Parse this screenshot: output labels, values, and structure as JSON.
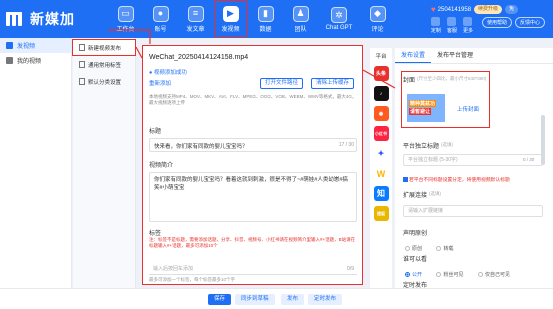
{
  "app": {
    "title": "新媒加"
  },
  "nav": {
    "items": [
      {
        "label": "工作台"
      },
      {
        "label": "账号"
      },
      {
        "label": "发文章"
      },
      {
        "label": "发视频",
        "active": true
      },
      {
        "label": "数据"
      },
      {
        "label": "团队"
      },
      {
        "label": "Chat GPT"
      },
      {
        "label": "评论"
      }
    ]
  },
  "header_right": {
    "phone": "2504141958",
    "vip": "续费升级",
    "badge2": "免",
    "icons": [
      "定制",
      "客服",
      "更多"
    ],
    "help": "使用帮助",
    "feedback": "反馈中心"
  },
  "sidebar": {
    "items": [
      {
        "label": "发视频",
        "active": true
      },
      {
        "label": "我的视频"
      }
    ]
  },
  "subbar": {
    "items": [
      {
        "label": "新建视频发布"
      },
      {
        "label": "通用常用标签"
      },
      {
        "label": "默认分类设置"
      }
    ]
  },
  "form": {
    "file_name": "WeChat_20250414124158.mp4",
    "upload_status": "视频添加成功",
    "re_add": "重新添加",
    "open_folder": "打开文件路径",
    "clear_upload": "清除上传缓存",
    "hint": "本地视频支持MP4、MOV、MKV、AVI、FLV、MPEG、OGG、VOB、WEBM、WMV等格式，最大4G，最大视频逐项上传",
    "title_label": "标题",
    "title_value": "快来看，你们家有同款的婴儿宝宝吗？",
    "title_count": "17 / 30",
    "desc_label": "视频简介",
    "desc_value": "你们家有同款的婴儿宝宝吗？看着这就到刺激，很是不得了~#萌娃#人类幼崽#搞笑#小萌宝宝",
    "tags_label": "标签",
    "tags_warn": "注：标签不是标题，需要添加话题，分享、抖音、视频号、小红书请在视频简介里输入#+话题，B站请在标题输入#+话题，最多可添加10个",
    "tags_placeholder": "输入后按回车添加",
    "tags_count": "0/9",
    "tags_hint": "最多可添加一个标签，每个标签最多10个字"
  },
  "platforms": {
    "title": "平台",
    "items": [
      {
        "name": "头条",
        "color": "#e8302c"
      },
      {
        "name": "抖音",
        "color": "#111111"
      },
      {
        "name": "快手",
        "color": "#ff5a1f"
      },
      {
        "name": "小红书",
        "color": "#ff2442"
      },
      {
        "name": "百家号",
        "color": "#2b55ff"
      },
      {
        "name": "微视",
        "color": "#ffb400"
      },
      {
        "name": "知乎",
        "color": "#0a7cff"
      },
      {
        "name": "搜狐",
        "color": "#e9b600"
      }
    ]
  },
  "settings": {
    "tab_active": "发布设置",
    "tab_other": "发布平台管理",
    "cover_label": "封面",
    "cover_hint": "(尺寸至少四比，最小尺寸640*360)",
    "thumb_line1": "精种莫兹功",
    "thumb_line2": "请暂避让",
    "upload_cover": "上传封面",
    "platform_title_label": "平台独立标题",
    "platform_title_hint": "(选填)",
    "platform_title_placeholder": "平台独立标题 (5-30字)",
    "platform_title_count": "0 / 30",
    "red_note": "若平台不同标题设置分定，将使用视频默认标题",
    "ext_label": "扩展连接",
    "ext_hint": "(选填)",
    "ext_placeholder": "请输入扩展链接",
    "declare_label": "声明原创",
    "declare_on": "原创",
    "declare_off": "转载",
    "visibility_label": "谁可以看",
    "visibility_opts": [
      "公开",
      "粉丝可见",
      "仅自己可见"
    ],
    "schedule_label": "定时发布"
  },
  "bottom": {
    "save": "保存",
    "sync": "同步到草稿",
    "publish": "发布",
    "timed": "定时发布"
  }
}
